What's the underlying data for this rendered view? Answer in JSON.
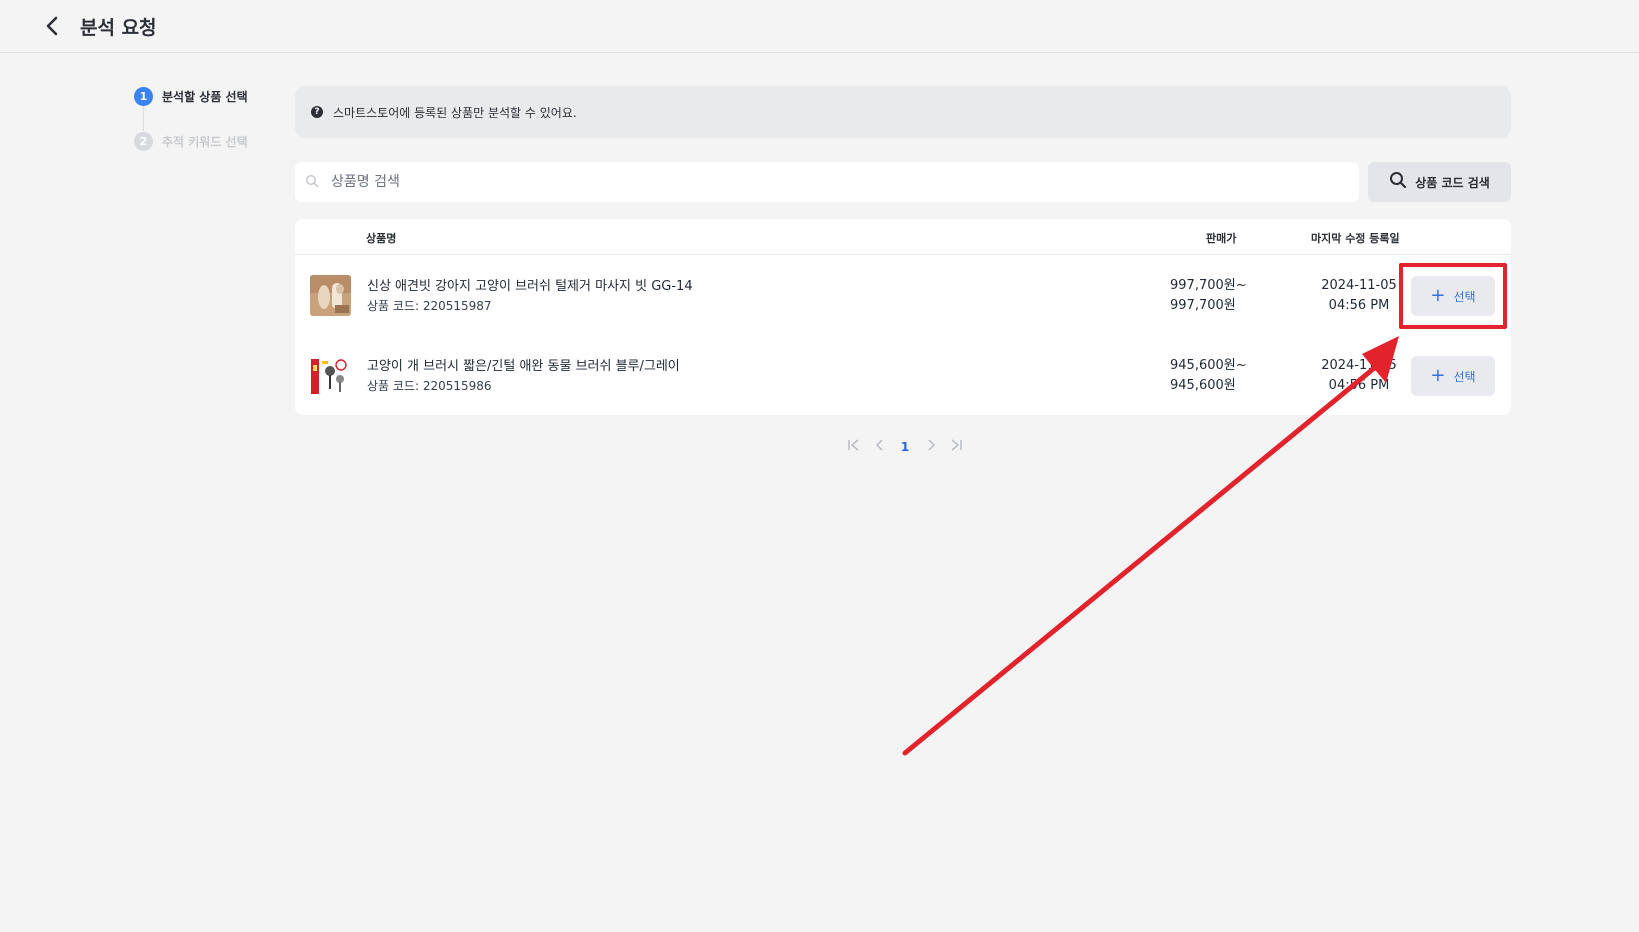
{
  "header": {
    "title": "분석 요청"
  },
  "steps": [
    {
      "num": "1",
      "label": "분석할 상품 선택"
    },
    {
      "num": "2",
      "label": "추적 키워드 선택"
    }
  ],
  "notice": {
    "icon": "question-circle-icon",
    "text": "스마트스토어에 등록된 상품만 분석할 수 있어요."
  },
  "search": {
    "placeholder": "상품명 검색",
    "code_search_label": "상품 코드 검색"
  },
  "table": {
    "headers": {
      "name": "상품명",
      "price": "판매가",
      "date": "마지막 수정 등록일"
    },
    "rows": [
      {
        "name": "신상 애견빗 강아지 고양이 브러쉬 털제거 마사지 빗 GG-14",
        "code": "상품 코드: 220515987",
        "price_min": "997,700원~",
        "price_max": "997,700원",
        "date": "2024-11-05",
        "time": "04:56 PM",
        "select_plus": "+",
        "select_label": "선택"
      },
      {
        "name": "고양이 개 브러시 짧은/긴털 애완 동물 브러쉬 블루/그레이",
        "code": "상품 코드: 220515986",
        "price_min": "945,600원~",
        "price_max": "945,600원",
        "date": "2024-11-05",
        "time": "04:56 PM",
        "select_plus": "+",
        "select_label": "선택"
      }
    ]
  },
  "pagination": {
    "first": "|<",
    "prev": "<",
    "current": "1",
    "next": ">",
    "last": ">|"
  },
  "colors": {
    "accent": "#3b82f6",
    "annotation": "#e3232c",
    "background": "#f4f4f5"
  }
}
